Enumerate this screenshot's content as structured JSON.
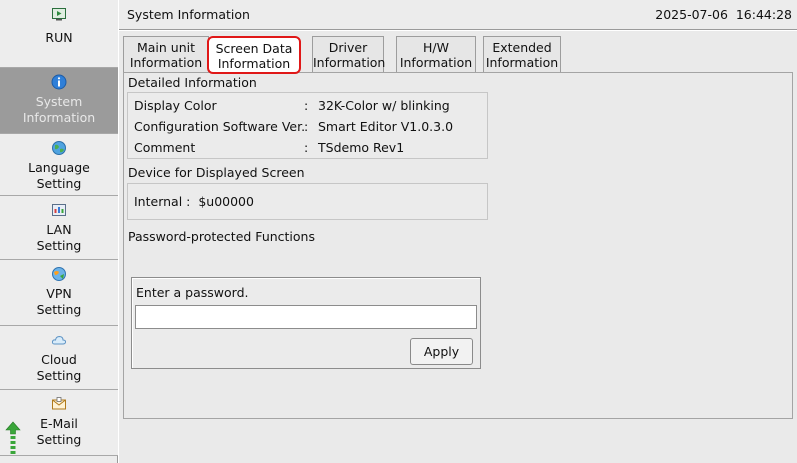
{
  "header": {
    "title": "System Information",
    "datetime": "2025-07-06  16:44:28"
  },
  "sidebar": {
    "items": [
      {
        "id": "run",
        "label": "RUN",
        "icon": "monitor-play-icon"
      },
      {
        "id": "system-information",
        "label": "System\nInformation",
        "icon": "info-icon",
        "active": true
      },
      {
        "id": "language-setting",
        "label": "Language\nSetting",
        "icon": "globe-icon"
      },
      {
        "id": "lan-setting",
        "label": "LAN\nSetting",
        "icon": "network-icon"
      },
      {
        "id": "vpn-setting",
        "label": "VPN\nSetting",
        "icon": "vpn-icon"
      },
      {
        "id": "cloud-setting",
        "label": "Cloud\nSetting",
        "icon": "cloud-icon"
      },
      {
        "id": "email-setting",
        "label": "E-Mail\nSetting",
        "icon": "mail-icon"
      }
    ]
  },
  "tabs": [
    {
      "label": "Main unit\nInformation"
    },
    {
      "label": "Screen Data\nInformation",
      "selected": true
    },
    {
      "label": "Driver\nInformation"
    },
    {
      "label": "H/W\nInformation"
    },
    {
      "label": "Extended\nInformation"
    }
  ],
  "detailed": {
    "title": "Detailed Information",
    "rows": [
      {
        "key": "Display Color",
        "value": "32K-Color w/ blinking"
      },
      {
        "key": "Configuration Software Ver.",
        "value": "Smart Editor V1.0.3.0"
      },
      {
        "key": "Comment",
        "value": "TSdemo Rev1"
      }
    ]
  },
  "device": {
    "title": "Device for Displayed Screen",
    "label": "Internal :",
    "value": "$u00000"
  },
  "password": {
    "title": "Password-protected Functions",
    "prompt": "Enter a password.",
    "input_value": "",
    "apply_label": "Apply"
  },
  "colors": {
    "selected_tab_outline": "#e01818",
    "active_sidebar": "#9b9b9b",
    "scroll_arrow": "#3aa63a"
  }
}
